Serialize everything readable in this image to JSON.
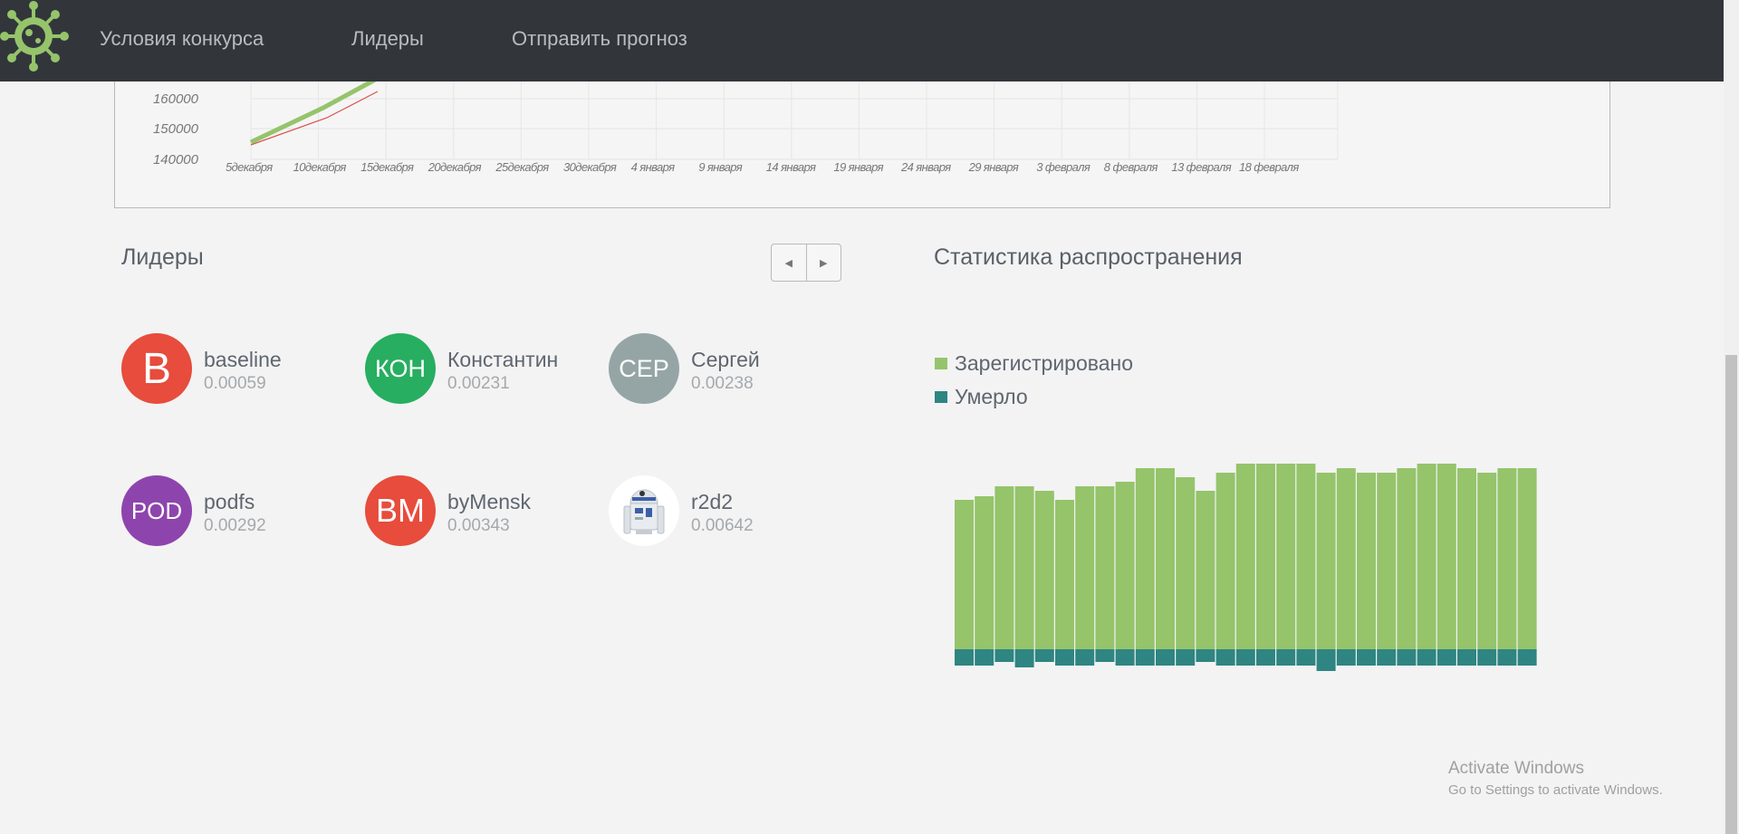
{
  "nav": {
    "links": [
      "Условия конкурса",
      "Лидеры",
      "Отправить прогноз"
    ]
  },
  "colors": {
    "accent_green": "#95c46b",
    "teal": "#2e8582",
    "navbar": "#32363b",
    "red_line": "#d9534f"
  },
  "cases_chart": {
    "type": "line",
    "y_ticks": [
      "160000",
      "150000",
      "140000"
    ],
    "x_ticks": [
      "5декабря",
      "10декабря",
      "15декабря",
      "20декабря",
      "25декабря",
      "30декабря",
      "4 января",
      "9 января",
      "14 января",
      "19 января",
      "24 января",
      "29 января",
      "3 февраля",
      "8 февраля",
      "13 февраля",
      "18 февраля"
    ]
  },
  "leaders": {
    "title": "Лидеры",
    "pager_icons": [
      "caret-left-icon",
      "caret-right-icon"
    ],
    "items": [
      {
        "initials": "B",
        "name": "baseline",
        "score": "0.00059",
        "color": "#e74c3c"
      },
      {
        "initials": "КОН",
        "name": "Константин",
        "score": "0.00231",
        "color": "#27ae60"
      },
      {
        "initials": "СЕР",
        "name": "Сергей",
        "score": "0.00238",
        "color": "#95a5a6"
      },
      {
        "initials": "POD",
        "name": "podfs",
        "score": "0.00292",
        "color": "#8e44ad"
      },
      {
        "initials": "BM",
        "name": "byMensk",
        "score": "0.00343",
        "color": "#e74c3c"
      },
      {
        "initials": "",
        "name": "r2d2",
        "score": "0.00642",
        "color": "#ffffff"
      }
    ]
  },
  "stats": {
    "title": "Статистика распространения",
    "legend": [
      {
        "label": "Зарегистрировано",
        "color": "#95c46b"
      },
      {
        "label": "Умерло",
        "color": "#2e8582"
      }
    ]
  },
  "chart_data": {
    "type": "bar",
    "series": [
      {
        "name": "Зарегистрировано",
        "values": [
          165,
          169,
          180,
          180,
          175,
          165,
          180,
          180,
          185,
          200,
          200,
          190,
          175,
          195,
          205,
          205,
          205,
          205,
          195,
          200,
          195,
          195,
          200,
          205,
          205,
          200,
          195,
          200,
          200
        ]
      },
      {
        "name": "Умерло",
        "values": [
          18,
          18,
          14,
          20,
          14,
          18,
          18,
          14,
          18,
          18,
          18,
          18,
          14,
          18,
          18,
          18,
          18,
          18,
          24,
          18,
          18,
          18,
          18,
          18,
          18,
          18,
          18,
          18,
          18
        ]
      }
    ]
  },
  "watermark": {
    "title": "Activate Windows",
    "subtitle": "Go to Settings to activate Windows."
  }
}
